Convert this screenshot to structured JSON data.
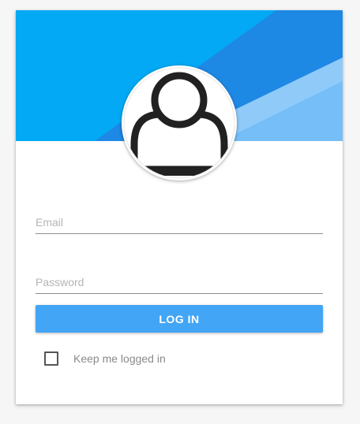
{
  "login_form": {
    "banner": {
      "colors": {
        "base": "#03a9f4",
        "mid": "#1e88e5",
        "light": "#90caf9",
        "pale": "#64b5f6"
      }
    },
    "avatar": {
      "icon": "user-avatar-icon",
      "colors": {
        "icon": "#212121",
        "ring": "#ffffff"
      }
    },
    "email": {
      "placeholder": "Email",
      "value": ""
    },
    "password": {
      "placeholder": "Password",
      "value": ""
    },
    "login_button": {
      "label": "LOG IN",
      "color": "#42a5f5"
    },
    "remember_me": {
      "label": "Keep me logged in",
      "checked": false
    }
  }
}
